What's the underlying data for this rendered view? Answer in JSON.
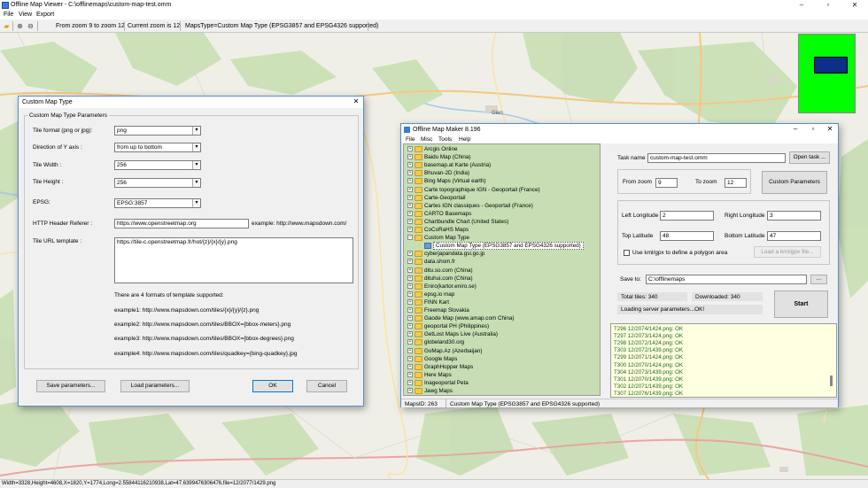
{
  "viewer": {
    "title": "Offline Map Viewer - C:\\offlinemaps\\custom-map-test.omm",
    "menu": [
      "File",
      "View",
      "Export"
    ],
    "toolbar": {
      "zoom_range": "From zoom 9 to zoom 12",
      "current_zoom": "Current zoom is 12",
      "maps_type": "MapsType=Custom Map Type (EPSG3857 and EPSG4326 supported)"
    },
    "status": "Width=3328,Height=4608,X=1820,Y=1774,Long=2.55844116210938,Lat=47.6399476306476,file=12/2077/1429.png",
    "map_labels": [
      "Gien"
    ],
    "minimap_colors": {
      "background": "#00ff00",
      "viewport": "#0c2f8a"
    }
  },
  "custom_dialog": {
    "title": "Custom Map Type",
    "group_label": "Custom Map Type Parameters",
    "tile_format_label": "Tile format (png or jpg):",
    "tile_format_value": "png",
    "direction_label": "Direction of Y axis :",
    "direction_value": "from up to bottom",
    "tile_width_label": "Tile Width :",
    "tile_width_value": "256",
    "tile_height_label": "Tile Height :",
    "tile_height_value": "256",
    "epsg_label": "EPSG:",
    "epsg_value": "EPSG:3857",
    "referer_label": "HTTP Header Referer :",
    "referer_value": "https://www.openstreetmap.org",
    "referer_example": "example: http://www.mapsdown.com/",
    "url_template_label": "Tile URL template :",
    "url_template_value": "https://tile-c.openstreetmap.fr/hot/{z}/{x}/{y}.png",
    "formats_note": "There are 4 formats of template supported:",
    "examples": [
      "example1: http://www.mapsdown.com/tiles/{x}/{y}/{z}.png",
      "example2: http://www.mapsdown.com/tiles/BBOX={bbox-meters}.png",
      "example3: http://www.mapsdown.com/tiles/BBOX={bbox-degrees}.png",
      "example4: http://www.mapsdown.com/tiles/quadkey={bing-quadkey}.jpg"
    ],
    "save_button": "Save parameters...",
    "load_button": "Load parameters...",
    "ok_button": "OK",
    "cancel_button": "Cancel"
  },
  "maker": {
    "title": "Offline Map Maker 8.196",
    "menu": [
      "File",
      "Misc",
      "Tools",
      "Help"
    ],
    "tree": [
      "Arcgis Online",
      "Baidu Map (China)",
      "basemap.at Karte (Austria)",
      "Bhuvan-2D (India)",
      "Bing Maps (Virtual earth)",
      "Carte topographique IGN - Geoportail (France)",
      "Carte-Geoportail",
      "Cartes IGN classiques - Geoportail (France)",
      "CARTO Basemaps",
      "Chartbundle Chart (United States)",
      "CoCoRaHS Maps",
      "Custom Map Type",
      "Custom Map Type (EPSG3857 and EPSG4326 supported)",
      "cyberjapandata.gsi.go.jp",
      "data.shom.fr",
      "ditu.so.com (China)",
      "dituhui.com (China)",
      "Eniro(kartor.eniro.se)",
      "epsg.io map",
      "FINN Kart",
      "Freemap Slovakia",
      "Gaode Map (www.amap.com China)",
      "geoportal PH (Philippines)",
      "GetLost Maps Live (Australia)",
      "globeland30.org",
      "GoMap.Az (Azerbaijan)",
      "Google Maps",
      "GraphHopper Maps",
      "Here Maps",
      "Inageoportal Peta",
      "Jawg Maps"
    ],
    "task_name_label": "Task name",
    "task_name_value": "custom-map-test.omm",
    "open_task_button": "Open task ...",
    "from_zoom_label": "From zoom",
    "from_zoom_value": "9",
    "to_zoom_label": "To zoom",
    "to_zoom_value": "12",
    "custom_params_button": "Custom Parameters",
    "left_lon_label": "Left Longitude",
    "left_lon_value": "2",
    "right_lon_label": "Right Longitude",
    "right_lon_value": "3",
    "top_lat_label": "Top Latitude",
    "top_lat_value": "48",
    "bottom_lat_label": "Bottom Latitude",
    "bottom_lat_value": "47",
    "kml_checkbox_label": "Use kml/gpx to define a polygon area",
    "load_kml_button": "Load a kml/gpx file...",
    "save_to_label": "Save to:",
    "save_to_value": "C:\\offlinemaps",
    "browse_button": "...",
    "total_tiles": "Total tiles: 340",
    "downloaded": "Downloaded: 340",
    "status_msg": "Loading server parameters...OK!",
    "start_button": "Start",
    "log": [
      "T296 12/2074/1424.png: OK",
      "T297 12/2073/1424.png: OK",
      "T298 12/2072/1424.png: OK",
      "T303 12/2072/1439.png: OK",
      "T299 12/2071/1424.png: OK",
      "T300 12/2070/1424.png: OK",
      "T304 12/2073/1439.png: OK",
      "T301 12/2070/1439.png: OK",
      "T302 12/2071/1439.png: OK",
      "T307 12/2076/1439.png: OK"
    ],
    "maps_id": "MapsID: 263",
    "selected_map": "Custom Map Type (EPSG3857 and EPSG4326 supported)"
  }
}
